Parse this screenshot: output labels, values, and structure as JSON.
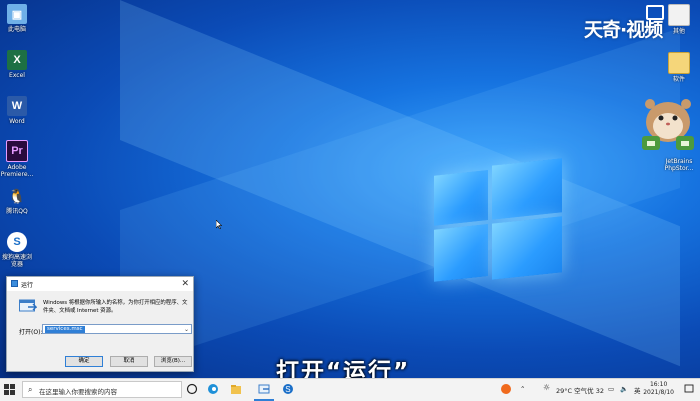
{
  "desktop": {
    "icons_left": [
      {
        "label": "此电脑",
        "glyph": "▣",
        "color": "#6fb0e8",
        "name": "this-pc"
      },
      {
        "label": "Excel",
        "glyph": "X",
        "color": "#1d7044",
        "name": "excel"
      },
      {
        "label": "Word",
        "glyph": "W",
        "color": "#2b5aa8",
        "name": "word"
      },
      {
        "label": "Adobe Premiere...",
        "glyph": "Pr",
        "color": "#2a0a3d",
        "name": "premiere"
      },
      {
        "label": "腾讯QQ",
        "glyph": "🐧",
        "color": "#1a1a1a",
        "name": "qq"
      },
      {
        "label": "搜狗高速浏览器",
        "glyph": "S",
        "color": "#1b6fc8",
        "name": "sogou-browser"
      }
    ],
    "icons_right": [
      {
        "label": "其他",
        "name": "other-folder"
      },
      {
        "label": "软件",
        "name": "software-folder"
      },
      {
        "label": "JetBrains PhpStor...",
        "name": "phpstorm"
      }
    ]
  },
  "watermark": {
    "text": "天奇·视频"
  },
  "run_dialog": {
    "title": "运行",
    "description": "Windows 将根据你所输入的名称，为你打开相应的程序、文件夹、文档或 Internet 资源。",
    "open_label": "打开(O):",
    "input_value": "services.msc",
    "ok_label": "确定",
    "cancel_label": "取消",
    "browse_label": "浏览(B)...",
    "close_glyph": "✕"
  },
  "subtitle": "打开“运行”",
  "taskbar": {
    "search_placeholder": "在这里输入你要搜索的内容",
    "weather": "29°C 空气优 32",
    "time": "16:10",
    "date": "2021/8/10",
    "accent": "#2f7fd6"
  }
}
